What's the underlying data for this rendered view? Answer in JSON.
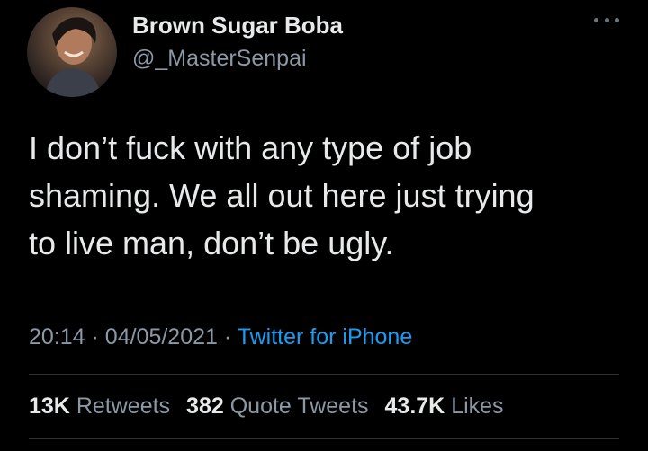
{
  "author": {
    "display_name": "Brown Sugar Boba",
    "handle": "@_MasterSenpai",
    "avatar_icon": "profile-photo"
  },
  "tweet": {
    "text": "I don’t fuck with any type of job\nshaming. We all out here just trying\nto live man, don’t be ugly.",
    "time": "20:14",
    "date": "04/05/2021",
    "separator": "·",
    "source": "Twitter for iPhone"
  },
  "stats": {
    "retweets_count": "13K",
    "retweets_label": "Retweets",
    "quotes_count": "382",
    "quotes_label": "Quote Tweets",
    "likes_count": "43.7K",
    "likes_label": "Likes"
  },
  "colors": {
    "background": "#000000",
    "text_primary": "#e7e9ea",
    "text_secondary": "#8b98a5",
    "link": "#1d9bf0",
    "divider": "#2f3336"
  },
  "icons": {
    "more": "more-horizontal-icon"
  }
}
